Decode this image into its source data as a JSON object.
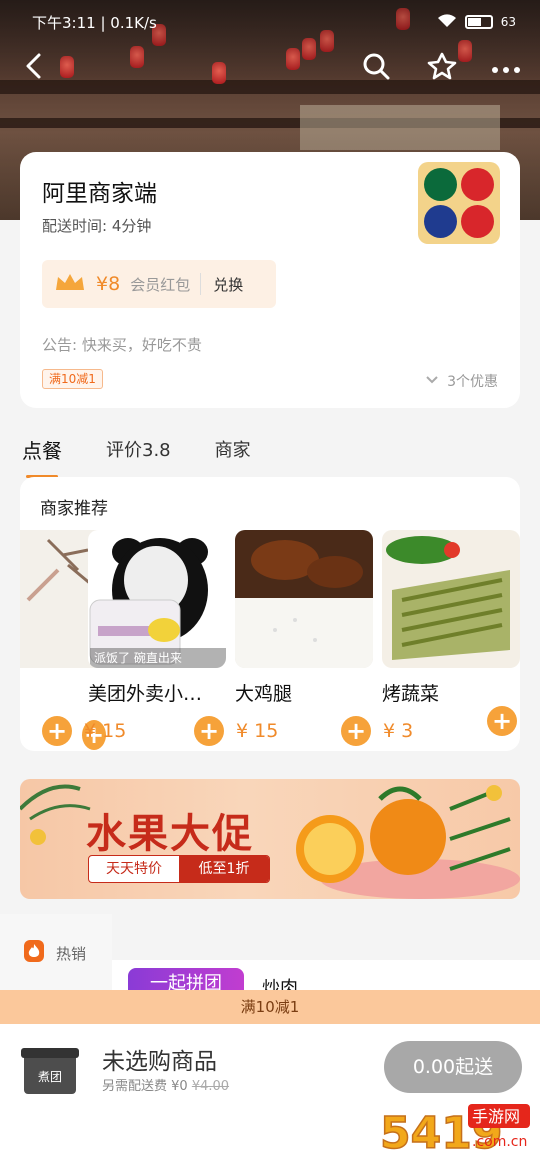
{
  "status_bar": {
    "time": "下午3:11",
    "speed": "0.1K/s",
    "battery": "63"
  },
  "header": {
    "back_icon": "chevron-left-icon",
    "search_icon": "search-icon",
    "favorite_icon": "star-outline-icon",
    "more_icon": "more-dots-icon"
  },
  "shop": {
    "name": "阿里商家端",
    "delivery_time": "配送时间: 4分钟",
    "red_packet": {
      "amount": "¥8",
      "label": "会员红包",
      "action": "兑换"
    },
    "notice": "公告: 快来买，好吃不贵",
    "discount_tag": "满10减1",
    "promos": "3个优惠"
  },
  "tabs": [
    {
      "label": "点餐",
      "active": true
    },
    {
      "label": "评价3.8",
      "active": false
    },
    {
      "label": "商家",
      "active": false
    }
  ],
  "recommend": {
    "title": "商家推荐",
    "items": [
      {
        "name": "美团外卖小…",
        "price": "¥ 15"
      },
      {
        "name": "大鸡腿",
        "price": "¥ 15"
      },
      {
        "name": "烤蔬菜",
        "price": "¥ 3"
      }
    ],
    "panda_caption": "派饭了 碗直出来"
  },
  "banner": {
    "title": "水果大促",
    "left_label": "天天特价",
    "right_label": "低至1折"
  },
  "hot": {
    "label": "热销",
    "thumb_text": "一起拼团",
    "product_name": "炒肉"
  },
  "bottom": {
    "promo_strip": "满10减1",
    "box_label": "煮团",
    "empty_text": "未选购商品",
    "fee_prefix": "另需配送费 ¥0",
    "fee_original": "¥4.00",
    "go_button": "0.00起送"
  },
  "watermark": {
    "text_main": "手游网",
    "text_domain": ".com.cn",
    "digits": "5419"
  },
  "colors": {
    "accent": "#f08a2a",
    "plus_button": "#f6a23a",
    "promo_strip": "#fbc89b",
    "banner_red": "#c62b1a"
  }
}
